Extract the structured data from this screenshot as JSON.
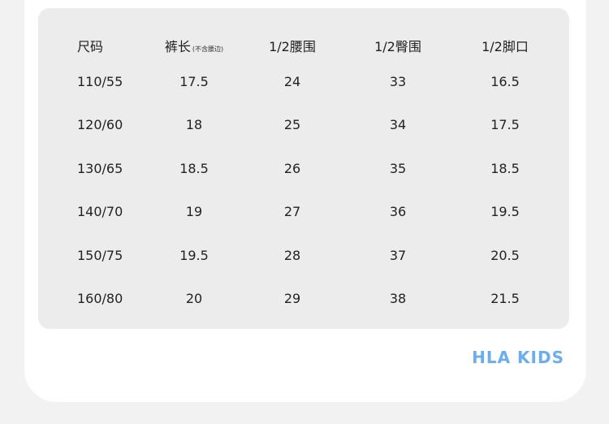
{
  "table": {
    "headers": [
      "尺码",
      "裤长",
      "1/2腰围",
      "1/2臀围",
      "1/2脚口"
    ],
    "length_note": "(不含腰边)",
    "rows": [
      [
        "110/55",
        "17.5",
        "24",
        "33",
        "16.5"
      ],
      [
        "120/60",
        "18",
        "25",
        "34",
        "17.5"
      ],
      [
        "130/65",
        "18.5",
        "26",
        "35",
        "18.5"
      ],
      [
        "140/70",
        "19",
        "27",
        "36",
        "19.5"
      ],
      [
        "150/75",
        "19.5",
        "28",
        "37",
        "20.5"
      ],
      [
        "160/80",
        "20",
        "29",
        "38",
        "21.5"
      ]
    ]
  },
  "brand": {
    "name": "HLA KIDS",
    "color": "#6aaef0"
  }
}
